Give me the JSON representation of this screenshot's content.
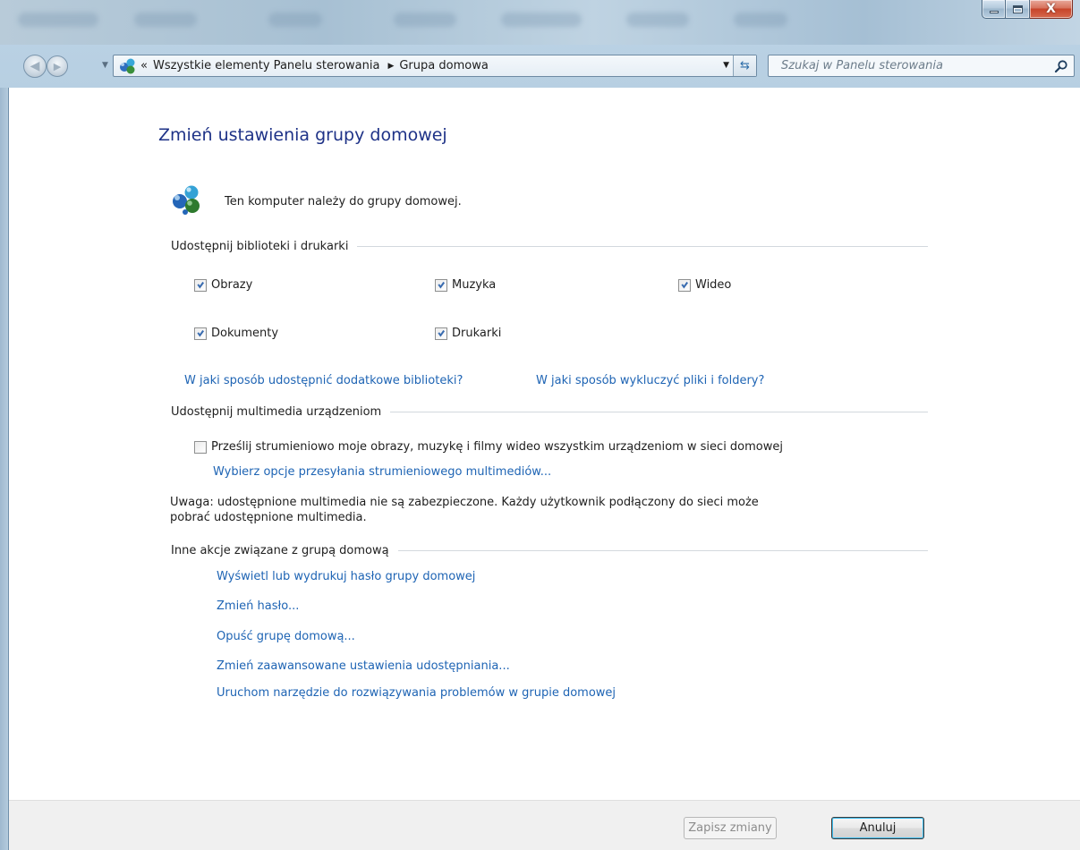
{
  "titlebar": {
    "minimize_icon": "minimize-icon",
    "maximize_icon": "maximize-icon",
    "close_glyph": "X"
  },
  "nav": {
    "chevron": "«",
    "breadcrumb": [
      "Wszystkie elementy Panelu sterowania",
      "Grupa domowa"
    ],
    "search_placeholder": "Szukaj w Panelu sterowania"
  },
  "page": {
    "title": "Zmień ustawienia grupy domowej",
    "membership_text": "Ten komputer należy do grupy domowej."
  },
  "libraries": {
    "heading": "Udostępnij biblioteki i drukarki",
    "items": [
      {
        "label": "Obrazy",
        "checked": true
      },
      {
        "label": "Muzyka",
        "checked": true
      },
      {
        "label": "Wideo",
        "checked": true
      },
      {
        "label": "Dokumenty",
        "checked": true
      },
      {
        "label": "Drukarki",
        "checked": true
      }
    ],
    "link_more_libraries": "W jaki sposób udostępnić dodatkowe biblioteki?",
    "link_exclude": "W jaki sposób wykluczyć pliki i foldery?"
  },
  "media": {
    "heading": "Udostępnij multimedia urządzeniom",
    "stream_label": "Prześlij strumieniowo moje obrazy, muzykę i filmy wideo wszystkim urządzeniom w sieci domowej",
    "stream_checked": false,
    "options_link": "Wybierz opcje przesyłania strumieniowego multimediów...",
    "note_line1": "Uwaga: udostępnione multimedia nie są zabezpieczone. Każdy użytkownik podłączony do sieci może",
    "note_line2": "pobrać udostępnione multimedia."
  },
  "other": {
    "heading": "Inne akcje związane z grupą domową",
    "links": [
      "Wyświetl lub wydrukuj hasło grupy domowej",
      "Zmień hasło...",
      "Opuść grupę domową...",
      "Zmień zaawansowane ustawienia udostępniania...",
      "Uruchom narzędzie do rozwiązywania problemów w grupie domowej"
    ]
  },
  "footer": {
    "save_label": "Zapisz zmiany",
    "cancel_label": "Anuluj"
  },
  "colors": {
    "link": "#1e64b4",
    "title": "#1e3287",
    "footer_bg": "#f0f0f0"
  }
}
